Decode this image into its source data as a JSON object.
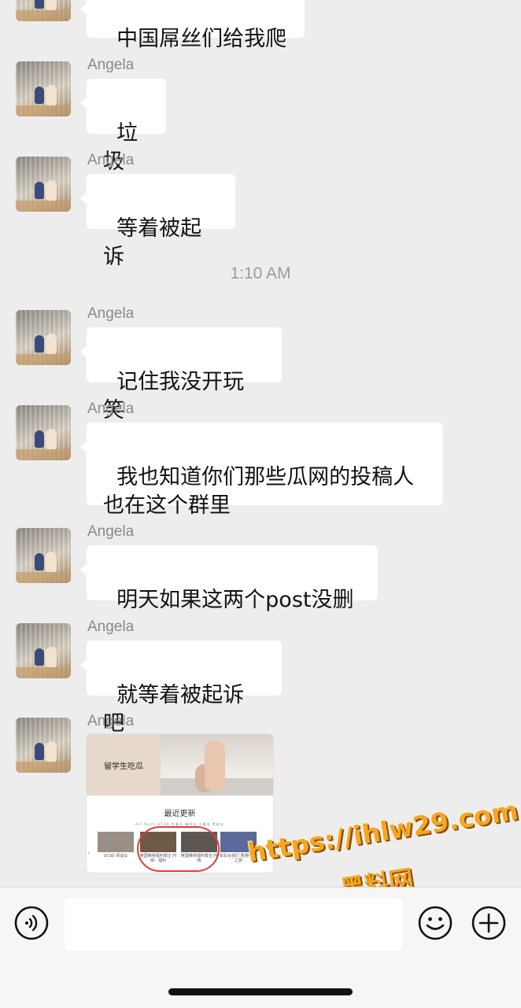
{
  "chat": {
    "timestamp": "1:10 AM",
    "messages": [
      {
        "sender": "",
        "text": "中国屌丝们给我爬"
      },
      {
        "sender": "Angela",
        "text": "垃圾"
      },
      {
        "sender": "Angela",
        "text": "等着被起诉"
      },
      {
        "sender": "Angela",
        "text": "记住我没开玩笑"
      },
      {
        "sender": "Angela",
        "text": "我也知道你们那些瓜网的投稿人\n也在这个群里"
      },
      {
        "sender": "Angela",
        "text": "明天如果这两个post没删"
      },
      {
        "sender": "Angela",
        "text": "就等着被起诉吧"
      },
      {
        "sender": "Angela",
        "text": ""
      }
    ],
    "image_card": {
      "banner_title": "留学生吃瓜",
      "section_title": "最近更新",
      "tabs": "All Posts   UCSD   生事瓜   福利瓜   主播瓜   黑料瓜",
      "captions": [
        "UCSD 闲谈瓜",
        "英国推特福利博主 时晴：福利",
        "英国推特福利博主 时晴",
        "单车女孩们 香港忙 杂之旅"
      ]
    }
  },
  "watermark": {
    "url": "https://ihlw29.com",
    "name": "黑料网"
  },
  "input_bar": {
    "placeholder": ""
  },
  "icons": {
    "voice": "voice-icon",
    "emoji": "emoji-icon",
    "plus": "plus-icon"
  }
}
